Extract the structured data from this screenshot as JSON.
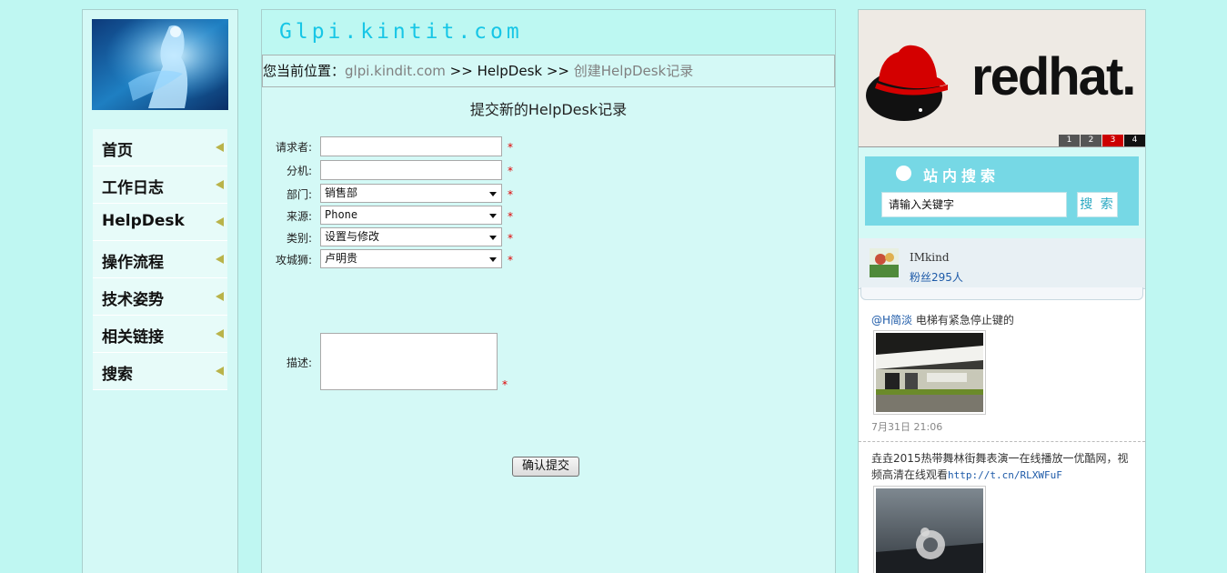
{
  "left_nav": {
    "items": [
      {
        "label": "首页"
      },
      {
        "label": "工作日志"
      },
      {
        "label": "HelpDesk"
      },
      {
        "label": "操作流程"
      },
      {
        "label": "技术姿势"
      },
      {
        "label": "相关链接"
      },
      {
        "label": "搜索"
      }
    ]
  },
  "header": {
    "site_title": "Glpi.kintit.com"
  },
  "breadcrumb": {
    "prefix": "您当前位置：",
    "home": "glpi.kindit.com",
    "sep1": " >> ",
    "section": "HelpDesk",
    "sep2": " >> ",
    "current": "创建HelpDesk记录"
  },
  "form": {
    "title": "提交新的HelpDesk记录",
    "requester_label": "请求者:",
    "requester_value": "",
    "extension_label": "分机:",
    "extension_value": "",
    "department_label": "部门:",
    "department_value": "销售部",
    "source_label": "来源:",
    "source_value": "Phone",
    "category_label": "类别:",
    "category_value": "设置与修改",
    "engineer_label": "攻城狮:",
    "engineer_value": "卢明贵",
    "description_label": "描述:",
    "required_mark": "*",
    "submit_label": "确认提交"
  },
  "banner": {
    "brand_text": "redhat.",
    "slides": [
      "1",
      "2",
      "3",
      "4"
    ],
    "active_slide": "3"
  },
  "site_search": {
    "title": "站内搜索",
    "placeholder": "请输入关键字",
    "button_label": "搜 索"
  },
  "weibo": {
    "user_name": "IMkind",
    "fans": "粉丝295人",
    "post1": {
      "at": "@H简淡",
      "text": " 电梯有紧急停止键的",
      "time": "7月31日 21:06"
    },
    "post2": {
      "text": "垚垚2015热带舞林街舞表演一在线播放一优酷网，视频高清在线观看",
      "link": "http://t.cn/RLXWFuF"
    }
  },
  "colors": {
    "page_bg": "#bff7f2",
    "panel_bg": "#d4f9f6",
    "title_cyan": "#17c6e6",
    "search_panel": "#76d8e5",
    "required_red": "#e00000",
    "slide_active": "#cc0000"
  }
}
